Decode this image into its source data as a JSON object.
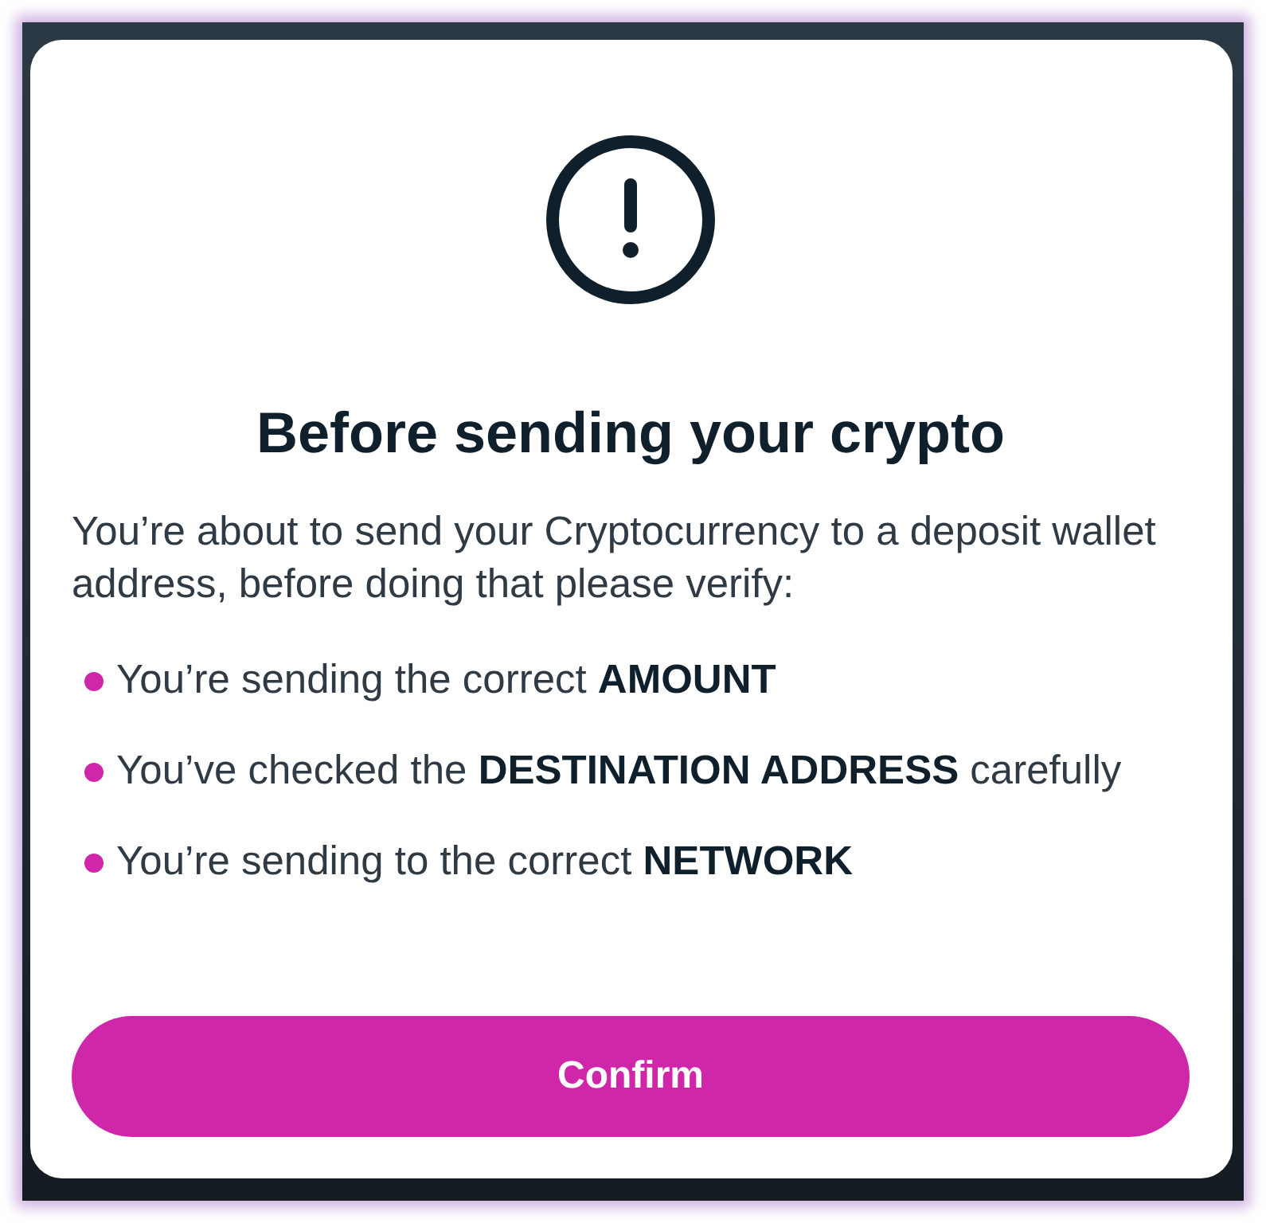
{
  "dialog": {
    "title": "Before sending your crypto",
    "intro": "You’re about to send your Cryptocurrency to a deposit wallet address, before doing that please verify:",
    "checklist": [
      {
        "text": "You’re sending the correct **AMOUNT**"
      },
      {
        "text": "You’ve checked the **DESTINATION ADDRESS** carefully"
      },
      {
        "text": "You’re sending to the correct **NETWORK**"
      }
    ],
    "confirm_button": "Confirm"
  }
}
